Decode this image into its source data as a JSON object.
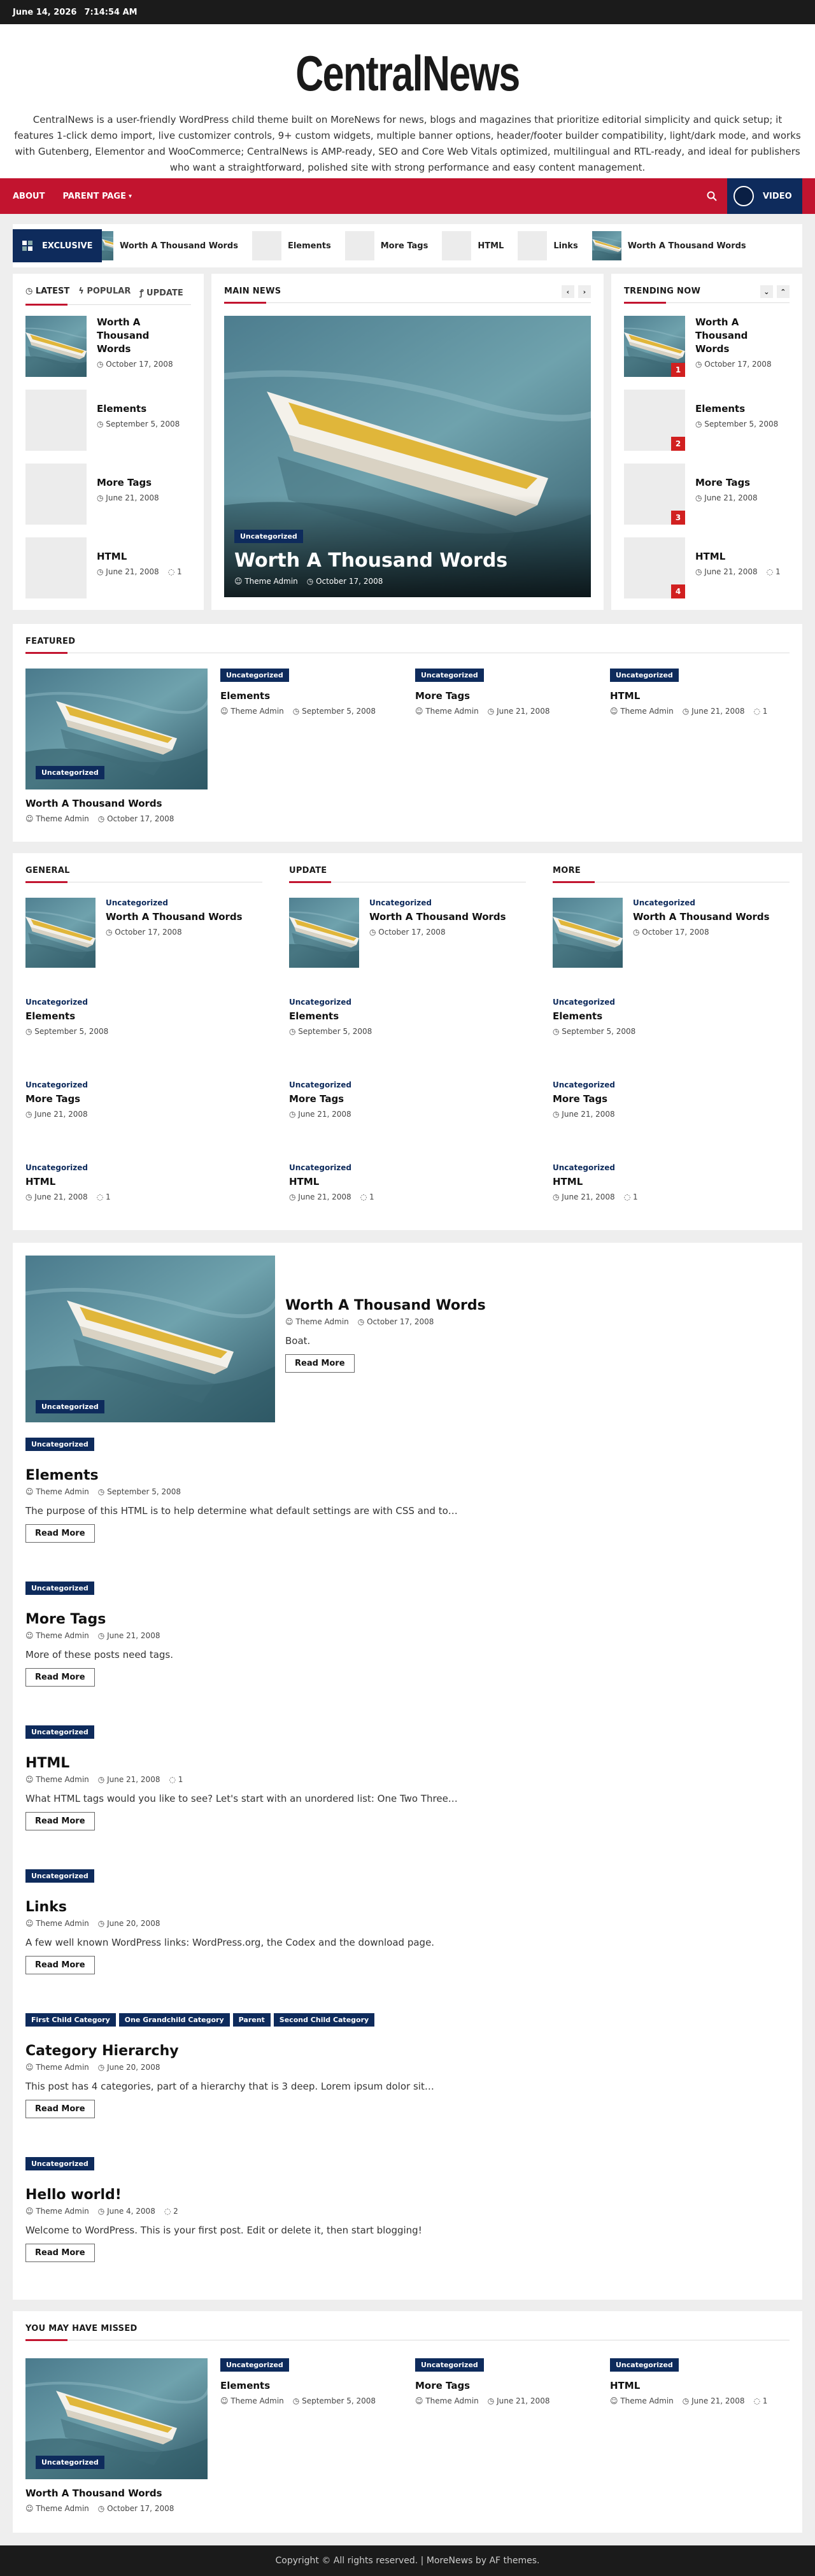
{
  "topbar": {
    "date": "June 14, 2026",
    "time": "7:14:54 AM"
  },
  "site": {
    "title": "CentralNews",
    "description": "CentralNews is a user-friendly WordPress child theme built on MoreNews for news, blogs and magazines that prioritize editorial simplicity and quick setup; it features 1-click demo import, live customizer controls, 9+ custom widgets, multiple banner options, header/footer builder compatibility, light/dark mode, and works with Gutenberg, Elementor and WooCommerce; CentralNews is AMP-ready, SEO and Core Web Vitals optimized, multilingual and RTL-ready, and ideal for publishers who want a straightforward, polished site with strong performance and easy content management."
  },
  "nav": {
    "about": "ABOUT",
    "parent": "PARENT PAGE",
    "video": "VIDEO"
  },
  "ticker": {
    "label": "EXCLUSIVE",
    "items": [
      "Worth A Thousand Words",
      "Elements",
      "More Tags",
      "HTML",
      "Links",
      "Worth A Thousand Words"
    ]
  },
  "tabs": {
    "latest": "LATEST",
    "popular": "POPULAR",
    "update": "UPDATE"
  },
  "latest": [
    {
      "title": "Worth A Thousand Words",
      "date": "October 17, 2008"
    },
    {
      "title": "Elements",
      "date": "September 5, 2008"
    },
    {
      "title": "More Tags",
      "date": "June 21, 2008"
    },
    {
      "title": "HTML",
      "date": "June 21, 2008",
      "comments": "1"
    }
  ],
  "main_news": {
    "heading": "MAIN NEWS",
    "category": "Uncategorized",
    "title": "Worth A Thousand Words",
    "author": "Theme Admin",
    "date": "October 17, 2008"
  },
  "trending": {
    "heading": "TRENDING NOW",
    "items": [
      {
        "title": "Worth A Thousand Words",
        "date": "October 17, 2008",
        "num": "1"
      },
      {
        "title": "Elements",
        "date": "September 5, 2008",
        "num": "2"
      },
      {
        "title": "More Tags",
        "date": "June 21, 2008",
        "num": "3"
      },
      {
        "title": "HTML",
        "date": "June 21, 2008",
        "comments": "1",
        "num": "4"
      }
    ]
  },
  "featured": {
    "heading": "FEATURED",
    "lead": {
      "category": "Uncategorized",
      "title": "Worth A Thousand Words",
      "author": "Theme Admin",
      "date": "October 17, 2008"
    },
    "items": [
      {
        "category": "Uncategorized",
        "title": "Elements",
        "author": "Theme Admin",
        "date": "September 5, 2008"
      },
      {
        "category": "Uncategorized",
        "title": "More Tags",
        "author": "Theme Admin",
        "date": "June 21, 2008"
      },
      {
        "category": "Uncategorized",
        "title": "HTML",
        "author": "Theme Admin",
        "date": "June 21, 2008",
        "comments": "1"
      }
    ]
  },
  "columns": [
    {
      "heading": "GENERAL"
    },
    {
      "heading": "UPDATE"
    },
    {
      "heading": "MORE"
    }
  ],
  "column_posts": [
    {
      "category": "Uncategorized",
      "title": "Worth A Thousand Words",
      "date": "October 17, 2008"
    },
    {
      "category": "Uncategorized",
      "title": "Elements",
      "date": "September 5, 2008"
    },
    {
      "category": "Uncategorized",
      "title": "More Tags",
      "date": "June 21, 2008"
    },
    {
      "category": "Uncategorized",
      "title": "HTML",
      "date": "June 21, 2008",
      "comments": "1"
    }
  ],
  "posts": [
    {
      "categories": [
        "Uncategorized"
      ],
      "title": "Worth A Thousand Words",
      "author": "Theme Admin",
      "date": "October 17, 2008",
      "excerpt": "Boat.",
      "read_more": "Read More"
    },
    {
      "categories": [
        "Uncategorized"
      ],
      "title": "Elements",
      "author": "Theme Admin",
      "date": "September 5, 2008",
      "excerpt": "The purpose of this HTML is to help determine what default settings are with CSS and to…",
      "read_more": "Read More"
    },
    {
      "categories": [
        "Uncategorized"
      ],
      "title": "More Tags",
      "author": "Theme Admin",
      "date": "June 21, 2008",
      "excerpt": "More of these posts need tags.",
      "read_more": "Read More"
    },
    {
      "categories": [
        "Uncategorized"
      ],
      "title": "HTML",
      "author": "Theme Admin",
      "date": "June 21, 2008",
      "comments": "1",
      "excerpt": "What HTML tags would you like to see? Let's start with an unordered list: One Two Three…",
      "read_more": "Read More"
    },
    {
      "categories": [
        "Uncategorized"
      ],
      "title": "Links",
      "author": "Theme Admin",
      "date": "June 20, 2008",
      "excerpt": "A few well known WordPress links: WordPress.org, the Codex and the download page.",
      "read_more": "Read More"
    },
    {
      "categories": [
        "First Child Category",
        "One Grandchild Category",
        "Parent",
        "Second Child Category"
      ],
      "title": "Category Hierarchy",
      "author": "Theme Admin",
      "date": "June 20, 2008",
      "excerpt": "This post has 4 categories, part of a hierarchy that is 3 deep. Lorem ipsum dolor sit…",
      "read_more": "Read More"
    },
    {
      "categories": [
        "Uncategorized"
      ],
      "title": "Hello world!",
      "author": "Theme Admin",
      "date": "June 4, 2008",
      "comments": "2",
      "excerpt": "Welcome to WordPress. This is your first post. Edit or delete it, then start blogging!",
      "read_more": "Read More"
    }
  ],
  "missed": {
    "heading": "YOU MAY HAVE MISSED",
    "lead": {
      "category": "Uncategorized",
      "title": "Worth A Thousand Words",
      "author": "Theme Admin",
      "date": "October 17, 2008"
    },
    "items": [
      {
        "category": "Uncategorized",
        "title": "Elements",
        "author": "Theme Admin",
        "date": "September 5, 2008"
      },
      {
        "category": "Uncategorized",
        "title": "More Tags",
        "author": "Theme Admin",
        "date": "June 21, 2008"
      },
      {
        "category": "Uncategorized",
        "title": "HTML",
        "author": "Theme Admin",
        "date": "June 21, 2008",
        "comments": "1"
      }
    ]
  },
  "footer": {
    "text": "Copyright © All rights reserved. | MoreNews by AF themes."
  },
  "colors": {
    "accent": "#c2142f",
    "navy": "#0e2b5c",
    "dark": "#1b1b1b"
  }
}
